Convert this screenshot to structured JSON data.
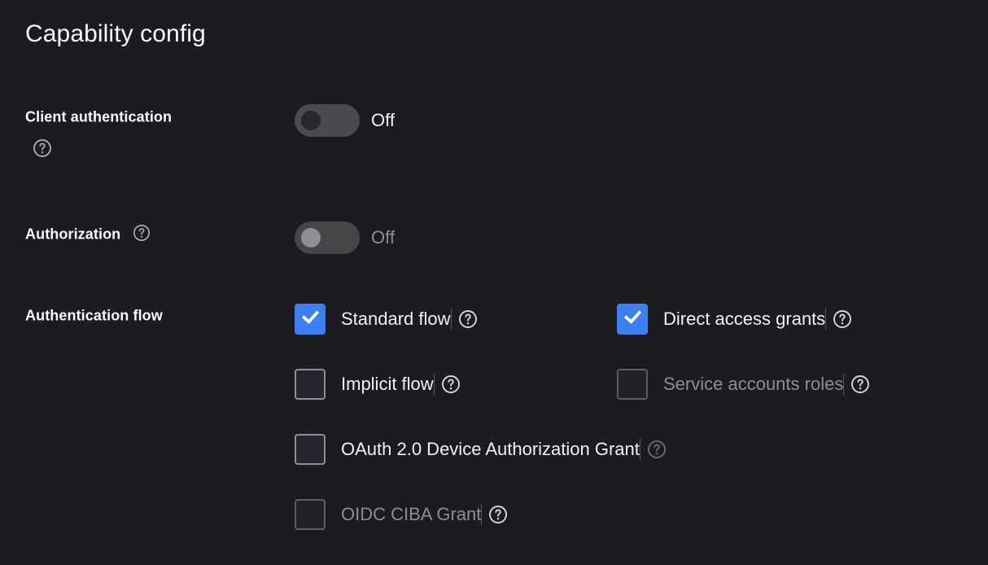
{
  "section": {
    "title": "Capability config"
  },
  "colors": {
    "background": "#1b1b20",
    "accent_checkbox": "#3d7ef0",
    "text_primary": "#f1f1f1",
    "text_muted": "#8d8d95",
    "toggle_track": "#4a4a50",
    "toggle_knob_off": "#27272c",
    "toggle_knob_disabled": "#8e8e94",
    "checkbox_border": "#8d8d99",
    "checkbox_border_disabled": "#5c5c66",
    "separator": "#55555e"
  },
  "rows": {
    "client_authentication": {
      "label": "Client authentication",
      "help_icon": "help-circle-icon",
      "toggle": {
        "state_label": "Off",
        "checked": false,
        "disabled": false
      }
    },
    "authorization": {
      "label": "Authorization",
      "help_icon": "help-circle-icon",
      "toggle": {
        "state_label": "Off",
        "checked": false,
        "disabled": true
      }
    },
    "authentication_flow": {
      "label": "Authentication flow",
      "options": [
        {
          "label": "Standard flow",
          "checked": true,
          "disabled": false,
          "help_icon": "help-circle-icon",
          "help_dim": false
        },
        {
          "label": "Direct access grants",
          "checked": true,
          "disabled": false,
          "help_icon": "help-circle-icon",
          "help_dim": false
        },
        {
          "label": "Implicit flow",
          "checked": false,
          "disabled": false,
          "help_icon": "help-circle-icon",
          "help_dim": false
        },
        {
          "label": "Service accounts roles",
          "checked": false,
          "disabled": true,
          "help_icon": "help-circle-icon",
          "help_dim": false
        },
        {
          "label": "OAuth 2.0 Device Authorization Grant",
          "checked": false,
          "disabled": false,
          "help_icon": "help-circle-icon",
          "help_dim": true
        },
        {
          "label": "OIDC CIBA Grant",
          "checked": false,
          "disabled": true,
          "help_icon": "help-circle-icon",
          "help_dim": false
        }
      ]
    }
  }
}
